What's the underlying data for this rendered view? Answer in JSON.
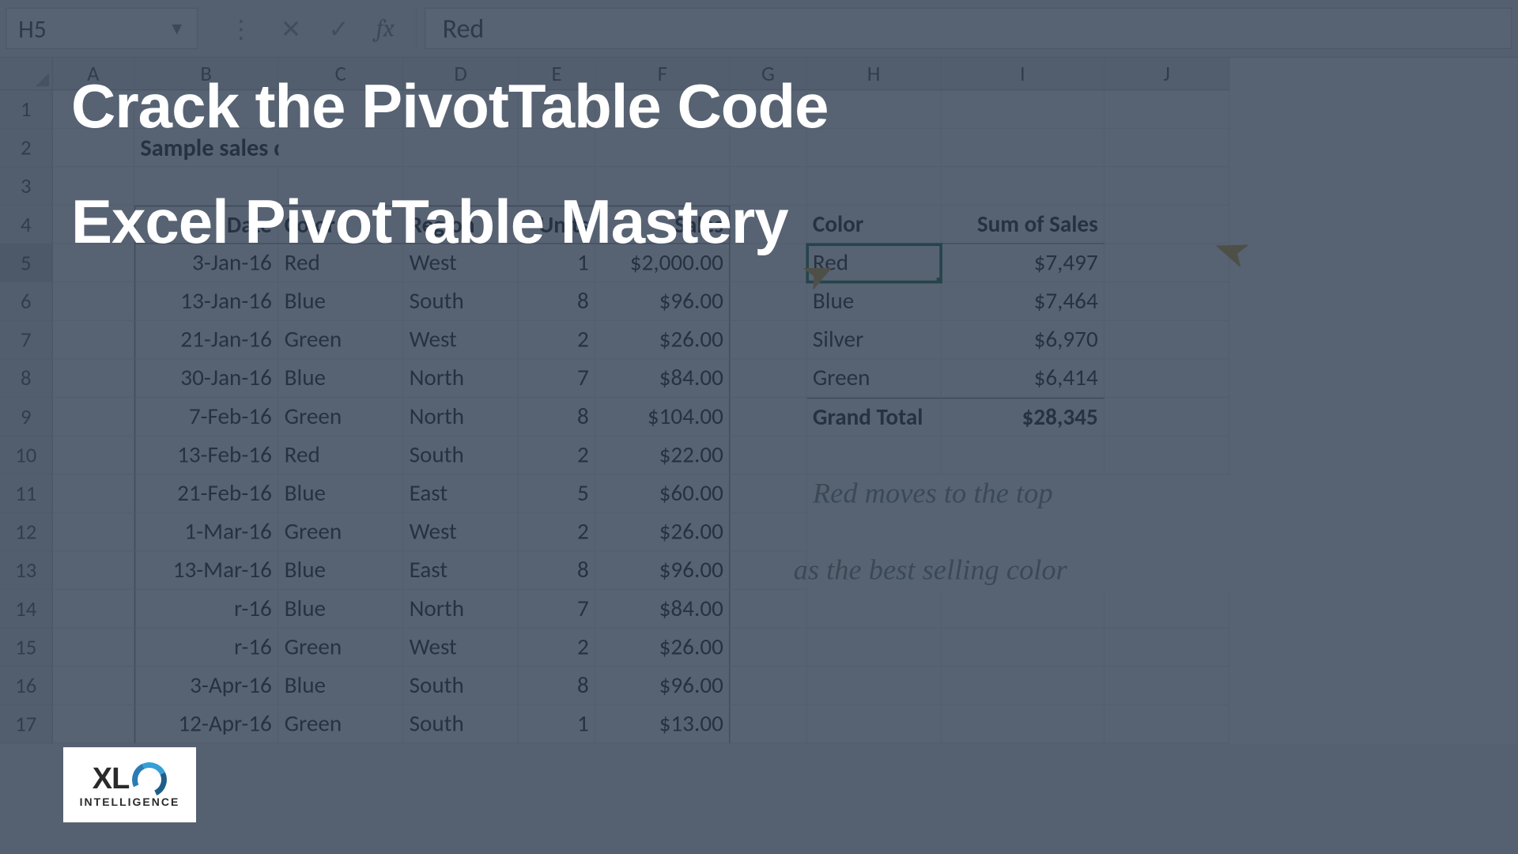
{
  "formula_bar": {
    "cell_ref": "H5",
    "value": "Red",
    "fx": "fx"
  },
  "columns": [
    "A",
    "B",
    "C",
    "D",
    "E",
    "F",
    "G",
    "H",
    "I",
    "J"
  ],
  "rows": [
    "1",
    "2",
    "3",
    "4",
    "5",
    "6",
    "7",
    "8",
    "9",
    "10",
    "11",
    "12",
    "13",
    "14",
    "15",
    "16",
    "17"
  ],
  "section_title": "Sample sales data",
  "table": {
    "headers": {
      "date": "Date",
      "color": "Color",
      "region": "Region",
      "units": "Units",
      "sales": "Sales"
    },
    "rows": [
      {
        "date": "3-Jan-16",
        "color": "Red",
        "region": "West",
        "units": "1",
        "sales": "$2,000.00"
      },
      {
        "date": "13-Jan-16",
        "color": "Blue",
        "region": "South",
        "units": "8",
        "sales": "$96.00"
      },
      {
        "date": "21-Jan-16",
        "color": "Green",
        "region": "West",
        "units": "2",
        "sales": "$26.00"
      },
      {
        "date": "30-Jan-16",
        "color": "Blue",
        "region": "North",
        "units": "7",
        "sales": "$84.00"
      },
      {
        "date": "7-Feb-16",
        "color": "Green",
        "region": "North",
        "units": "8",
        "sales": "$104.00"
      },
      {
        "date": "13-Feb-16",
        "color": "Red",
        "region": "South",
        "units": "2",
        "sales": "$22.00"
      },
      {
        "date": "21-Feb-16",
        "color": "Blue",
        "region": "East",
        "units": "5",
        "sales": "$60.00"
      },
      {
        "date": "1-Mar-16",
        "color": "Green",
        "region": "West",
        "units": "2",
        "sales": "$26.00"
      },
      {
        "date": "13-Mar-16",
        "color": "Blue",
        "region": "East",
        "units": "8",
        "sales": "$96.00"
      },
      {
        "date": "r-16",
        "color": "Blue",
        "region": "North",
        "units": "7",
        "sales": "$84.00"
      },
      {
        "date": "r-16",
        "color": "Green",
        "region": "West",
        "units": "2",
        "sales": "$26.00"
      },
      {
        "date": "3-Apr-16",
        "color": "Blue",
        "region": "South",
        "units": "8",
        "sales": "$96.00"
      },
      {
        "date": "12-Apr-16",
        "color": "Green",
        "region": "South",
        "units": "1",
        "sales": "$13.00"
      }
    ]
  },
  "pivot": {
    "headers": {
      "color": "Color",
      "sum": "Sum of Sales"
    },
    "rows": [
      {
        "color": "Red",
        "sum": "$7,497"
      },
      {
        "color": "Blue",
        "sum": "$7,464"
      },
      {
        "color": "Silver",
        "sum": "$6,970"
      },
      {
        "color": "Green",
        "sum": "$6,414"
      }
    ],
    "total": {
      "label": "Grand Total",
      "value": "$28,345"
    }
  },
  "annotation": {
    "line1": "Red moves to the top",
    "line2": "as the best selling color"
  },
  "overlay": {
    "title1": "Crack the PivotTable Code",
    "title2": "Excel PivotTable Mastery"
  },
  "logo": {
    "main": "XL",
    "sub": "INTELLIGENCE"
  }
}
